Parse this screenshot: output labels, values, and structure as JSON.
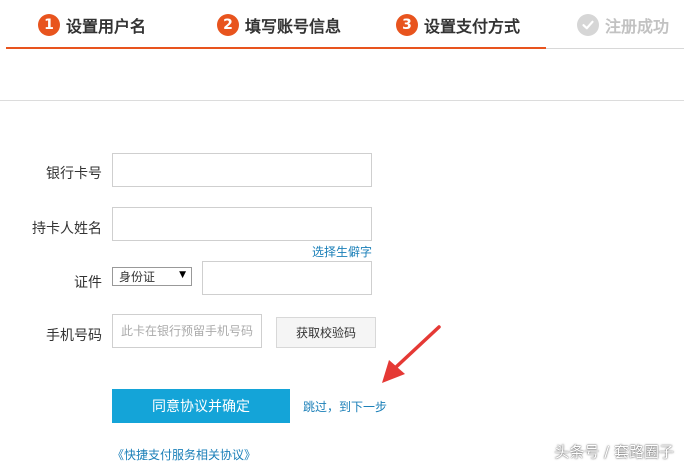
{
  "steps": [
    {
      "number": "1",
      "label": "设置用户名"
    },
    {
      "number": "2",
      "label": "填写账号信息"
    },
    {
      "number": "3",
      "label": "设置支付方式"
    },
    {
      "label": "注册成功"
    }
  ],
  "form": {
    "card_label": "银行卡号",
    "name_label": "持卡人姓名",
    "rare_char_link": "选择生僻字",
    "id_label": "证件",
    "id_type_selected": "身份证",
    "phone_label": "手机号码",
    "phone_placeholder": "此卡在银行预留手机号码",
    "get_code_button": "获取校验码",
    "submit_button": "同意协议并确定",
    "skip_link": "跳过，到下一步",
    "agreement_link": "《快捷支付服务相关协议》"
  },
  "watermark": "头条号 / 套路圈子",
  "colors": {
    "accent": "#e8541e",
    "primary_button": "#14a4d8",
    "link": "#1a7fb8",
    "annotation_arrow": "#e53935"
  }
}
